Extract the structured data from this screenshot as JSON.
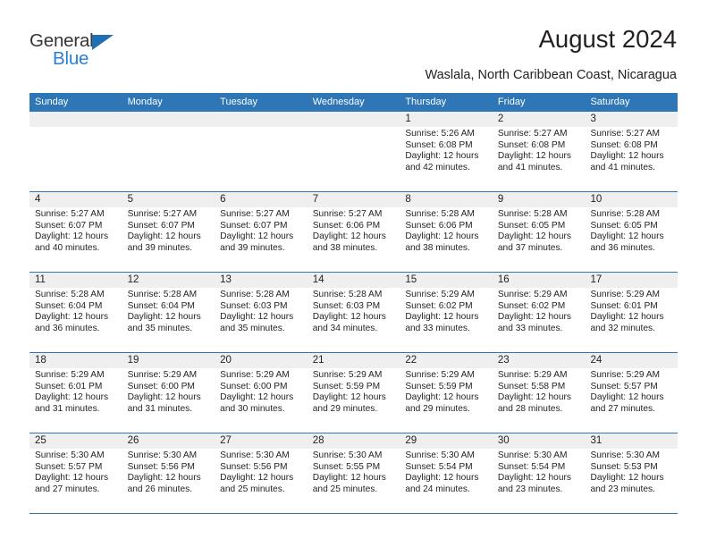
{
  "brand": {
    "name_primary": "General",
    "name_secondary": "Blue",
    "primary_color": "#353535",
    "secondary_color": "#2a7fd4",
    "triangle_color": "#1f6fb5"
  },
  "header": {
    "title": "August 2024",
    "location": "Waslala, North Caribbean Coast, Nicaragua",
    "accent_color": "#2e76b6",
    "band_color": "#efefef"
  },
  "calendar": {
    "day_names": [
      "Sunday",
      "Monday",
      "Tuesday",
      "Wednesday",
      "Thursday",
      "Friday",
      "Saturday"
    ],
    "weeks": [
      [
        {
          "day": "",
          "lines": []
        },
        {
          "day": "",
          "lines": []
        },
        {
          "day": "",
          "lines": []
        },
        {
          "day": "",
          "lines": []
        },
        {
          "day": "1",
          "lines": [
            "Sunrise: 5:26 AM",
            "Sunset: 6:08 PM",
            "Daylight: 12 hours",
            "and 42 minutes."
          ]
        },
        {
          "day": "2",
          "lines": [
            "Sunrise: 5:27 AM",
            "Sunset: 6:08 PM",
            "Daylight: 12 hours",
            "and 41 minutes."
          ]
        },
        {
          "day": "3",
          "lines": [
            "Sunrise: 5:27 AM",
            "Sunset: 6:08 PM",
            "Daylight: 12 hours",
            "and 41 minutes."
          ]
        }
      ],
      [
        {
          "day": "4",
          "lines": [
            "Sunrise: 5:27 AM",
            "Sunset: 6:07 PM",
            "Daylight: 12 hours",
            "and 40 minutes."
          ]
        },
        {
          "day": "5",
          "lines": [
            "Sunrise: 5:27 AM",
            "Sunset: 6:07 PM",
            "Daylight: 12 hours",
            "and 39 minutes."
          ]
        },
        {
          "day": "6",
          "lines": [
            "Sunrise: 5:27 AM",
            "Sunset: 6:07 PM",
            "Daylight: 12 hours",
            "and 39 minutes."
          ]
        },
        {
          "day": "7",
          "lines": [
            "Sunrise: 5:27 AM",
            "Sunset: 6:06 PM",
            "Daylight: 12 hours",
            "and 38 minutes."
          ]
        },
        {
          "day": "8",
          "lines": [
            "Sunrise: 5:28 AM",
            "Sunset: 6:06 PM",
            "Daylight: 12 hours",
            "and 38 minutes."
          ]
        },
        {
          "day": "9",
          "lines": [
            "Sunrise: 5:28 AM",
            "Sunset: 6:05 PM",
            "Daylight: 12 hours",
            "and 37 minutes."
          ]
        },
        {
          "day": "10",
          "lines": [
            "Sunrise: 5:28 AM",
            "Sunset: 6:05 PM",
            "Daylight: 12 hours",
            "and 36 minutes."
          ]
        }
      ],
      [
        {
          "day": "11",
          "lines": [
            "Sunrise: 5:28 AM",
            "Sunset: 6:04 PM",
            "Daylight: 12 hours",
            "and 36 minutes."
          ]
        },
        {
          "day": "12",
          "lines": [
            "Sunrise: 5:28 AM",
            "Sunset: 6:04 PM",
            "Daylight: 12 hours",
            "and 35 minutes."
          ]
        },
        {
          "day": "13",
          "lines": [
            "Sunrise: 5:28 AM",
            "Sunset: 6:03 PM",
            "Daylight: 12 hours",
            "and 35 minutes."
          ]
        },
        {
          "day": "14",
          "lines": [
            "Sunrise: 5:28 AM",
            "Sunset: 6:03 PM",
            "Daylight: 12 hours",
            "and 34 minutes."
          ]
        },
        {
          "day": "15",
          "lines": [
            "Sunrise: 5:29 AM",
            "Sunset: 6:02 PM",
            "Daylight: 12 hours",
            "and 33 minutes."
          ]
        },
        {
          "day": "16",
          "lines": [
            "Sunrise: 5:29 AM",
            "Sunset: 6:02 PM",
            "Daylight: 12 hours",
            "and 33 minutes."
          ]
        },
        {
          "day": "17",
          "lines": [
            "Sunrise: 5:29 AM",
            "Sunset: 6:01 PM",
            "Daylight: 12 hours",
            "and 32 minutes."
          ]
        }
      ],
      [
        {
          "day": "18",
          "lines": [
            "Sunrise: 5:29 AM",
            "Sunset: 6:01 PM",
            "Daylight: 12 hours",
            "and 31 minutes."
          ]
        },
        {
          "day": "19",
          "lines": [
            "Sunrise: 5:29 AM",
            "Sunset: 6:00 PM",
            "Daylight: 12 hours",
            "and 31 minutes."
          ]
        },
        {
          "day": "20",
          "lines": [
            "Sunrise: 5:29 AM",
            "Sunset: 6:00 PM",
            "Daylight: 12 hours",
            "and 30 minutes."
          ]
        },
        {
          "day": "21",
          "lines": [
            "Sunrise: 5:29 AM",
            "Sunset: 5:59 PM",
            "Daylight: 12 hours",
            "and 29 minutes."
          ]
        },
        {
          "day": "22",
          "lines": [
            "Sunrise: 5:29 AM",
            "Sunset: 5:59 PM",
            "Daylight: 12 hours",
            "and 29 minutes."
          ]
        },
        {
          "day": "23",
          "lines": [
            "Sunrise: 5:29 AM",
            "Sunset: 5:58 PM",
            "Daylight: 12 hours",
            "and 28 minutes."
          ]
        },
        {
          "day": "24",
          "lines": [
            "Sunrise: 5:29 AM",
            "Sunset: 5:57 PM",
            "Daylight: 12 hours",
            "and 27 minutes."
          ]
        }
      ],
      [
        {
          "day": "25",
          "lines": [
            "Sunrise: 5:30 AM",
            "Sunset: 5:57 PM",
            "Daylight: 12 hours",
            "and 27 minutes."
          ]
        },
        {
          "day": "26",
          "lines": [
            "Sunrise: 5:30 AM",
            "Sunset: 5:56 PM",
            "Daylight: 12 hours",
            "and 26 minutes."
          ]
        },
        {
          "day": "27",
          "lines": [
            "Sunrise: 5:30 AM",
            "Sunset: 5:56 PM",
            "Daylight: 12 hours",
            "and 25 minutes."
          ]
        },
        {
          "day": "28",
          "lines": [
            "Sunrise: 5:30 AM",
            "Sunset: 5:55 PM",
            "Daylight: 12 hours",
            "and 25 minutes."
          ]
        },
        {
          "day": "29",
          "lines": [
            "Sunrise: 5:30 AM",
            "Sunset: 5:54 PM",
            "Daylight: 12 hours",
            "and 24 minutes."
          ]
        },
        {
          "day": "30",
          "lines": [
            "Sunrise: 5:30 AM",
            "Sunset: 5:54 PM",
            "Daylight: 12 hours",
            "and 23 minutes."
          ]
        },
        {
          "day": "31",
          "lines": [
            "Sunrise: 5:30 AM",
            "Sunset: 5:53 PM",
            "Daylight: 12 hours",
            "and 23 minutes."
          ]
        }
      ]
    ]
  }
}
